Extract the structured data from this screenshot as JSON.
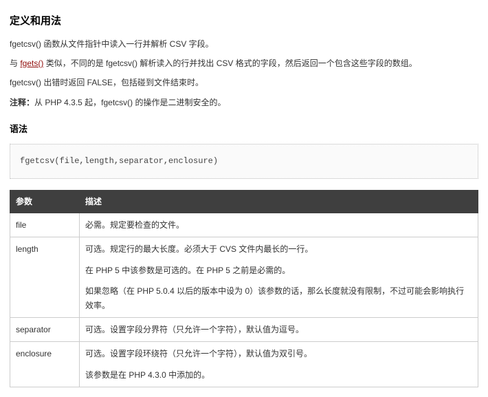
{
  "heading": "定义和用法",
  "intro1": "fgetcsv() 函数从文件指针中读入一行并解析 CSV 字段。",
  "intro2_a": "与 ",
  "intro2_link": "fgets()",
  "intro2_b": " 类似，不同的是 fgetcsv() 解析读入的行并找出 CSV 格式的字段，然后返回一个包含这些字段的数组。",
  "intro3": "fgetcsv() 出错时返回 FALSE，包括碰到文件结束时。",
  "note_label": "注释：",
  "note_body": "从 PHP 4.3.5 起，fgetcsv() 的操作是二进制安全的。",
  "syntax_heading": "语法",
  "syntax_code": "fgetcsv(file,length,separator,enclosure)",
  "table": {
    "th_param": "参数",
    "th_desc": "描述",
    "rows": [
      {
        "param": "file",
        "desc": [
          "必需。规定要检查的文件。"
        ]
      },
      {
        "param": "length",
        "desc": [
          "可选。规定行的最大长度。必须大于 CVS 文件内最长的一行。",
          "在 PHP 5 中该参数是可选的。在 PHP 5 之前是必需的。",
          "如果忽略（在 PHP 5.0.4 以后的版本中设为 0）该参数的话，那么长度就没有限制，不过可能会影响执行效率。"
        ]
      },
      {
        "param": "separator",
        "desc": [
          "可选。设置字段分界符（只允许一个字符），默认值为逗号。"
        ]
      },
      {
        "param": "enclosure",
        "desc": [
          "可选。设置字段环绕符（只允许一个字符），默认值为双引号。",
          "该参数是在 PHP 4.3.0 中添加的。"
        ]
      }
    ]
  }
}
